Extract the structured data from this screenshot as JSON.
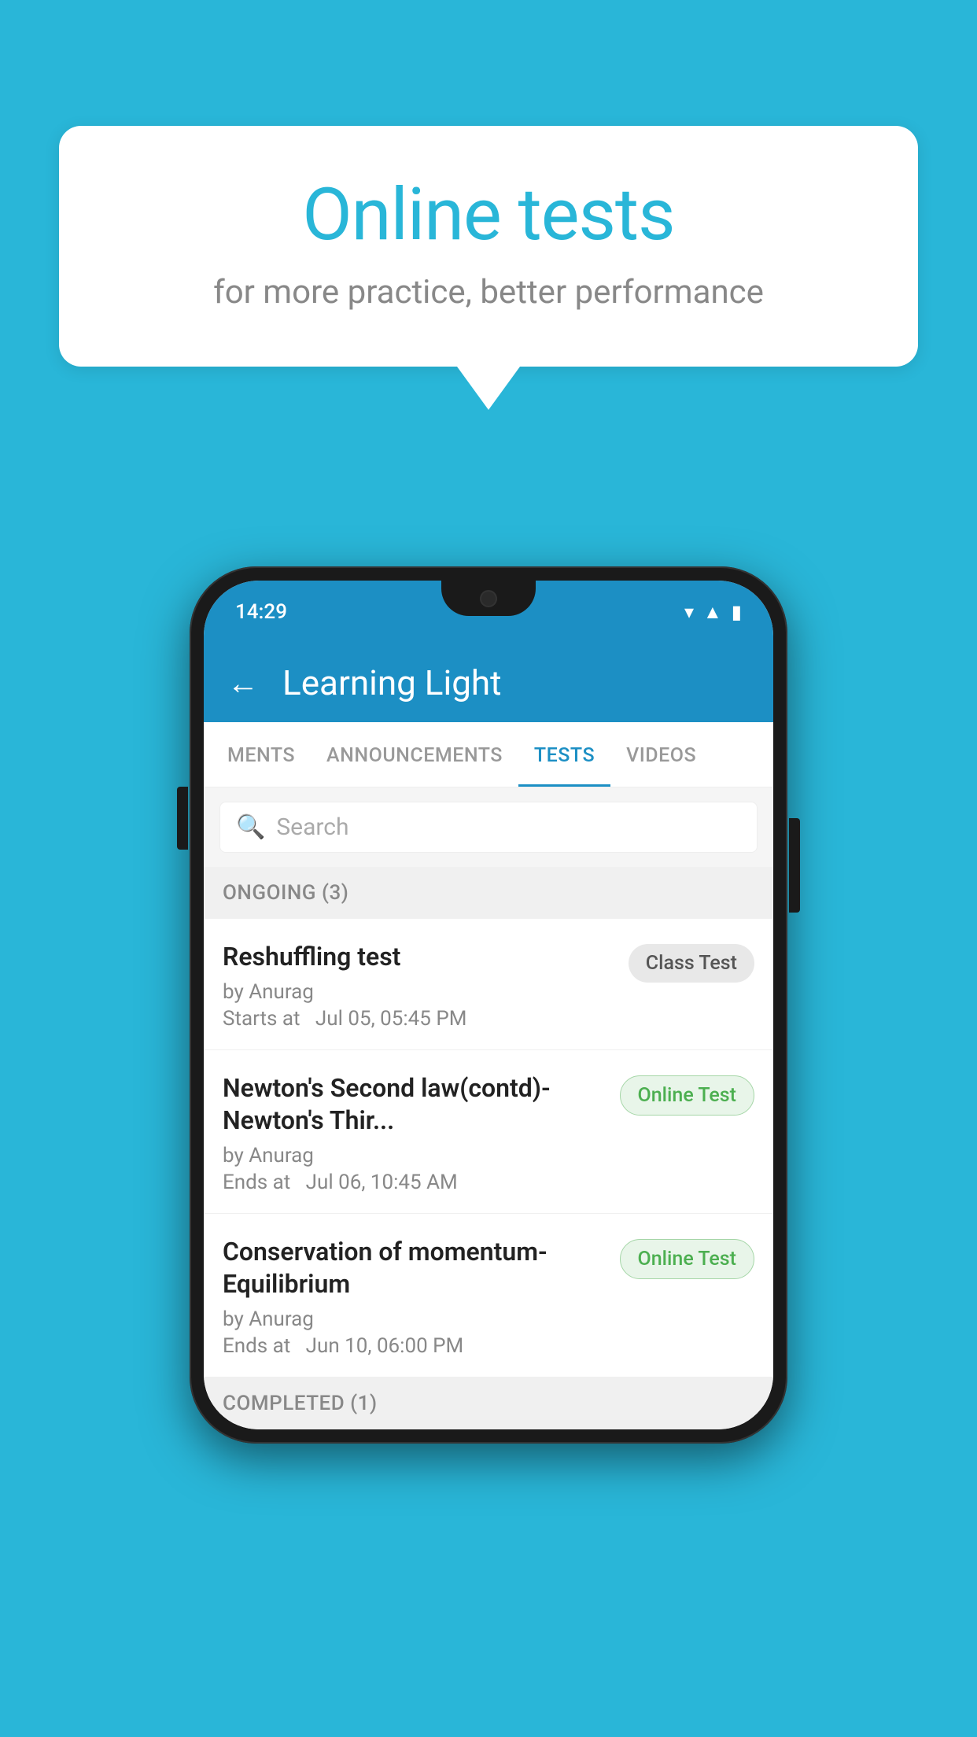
{
  "background_color": "#29b6d8",
  "speech_bubble": {
    "title": "Online tests",
    "subtitle": "for more practice, better performance"
  },
  "phone": {
    "status_bar": {
      "time": "14:29",
      "icons": [
        "wifi",
        "signal",
        "battery"
      ]
    },
    "app_header": {
      "title": "Learning Light",
      "back_label": "←"
    },
    "tabs": [
      {
        "label": "MENTS",
        "active": false
      },
      {
        "label": "ANNOUNCEMENTS",
        "active": false
      },
      {
        "label": "TESTS",
        "active": true
      },
      {
        "label": "VIDEOS",
        "active": false
      }
    ],
    "search": {
      "placeholder": "Search"
    },
    "ongoing_section": {
      "label": "ONGOING (3)"
    },
    "test_items": [
      {
        "title": "Reshuffling test",
        "author": "by Anurag",
        "time_label": "Starts at",
        "time_value": "Jul 05, 05:45 PM",
        "badge": "Class Test",
        "badge_type": "class"
      },
      {
        "title": "Newton's Second law(contd)-Newton's Thir...",
        "author": "by Anurag",
        "time_label": "Ends at",
        "time_value": "Jul 06, 10:45 AM",
        "badge": "Online Test",
        "badge_type": "online"
      },
      {
        "title": "Conservation of momentum-Equilibrium",
        "author": "by Anurag",
        "time_label": "Ends at",
        "time_value": "Jun 10, 06:00 PM",
        "badge": "Online Test",
        "badge_type": "online"
      }
    ],
    "completed_section": {
      "label": "COMPLETED (1)"
    }
  }
}
